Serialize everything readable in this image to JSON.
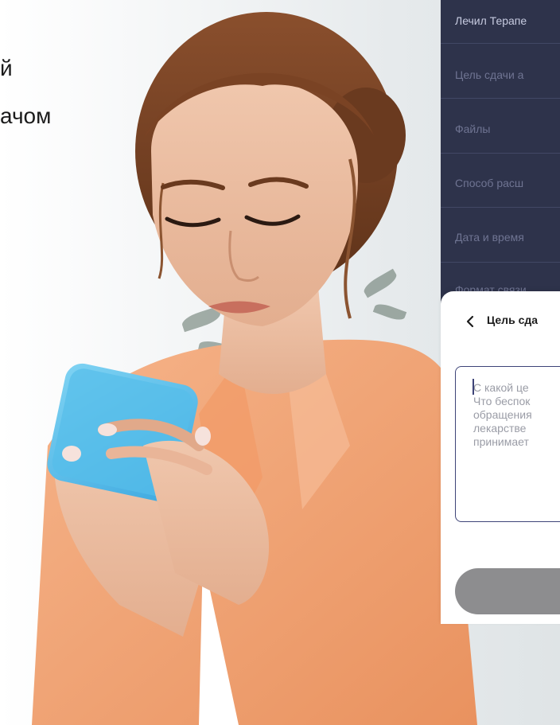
{
  "hero": {
    "line1": "й",
    "line2": "ачом"
  },
  "form": {
    "rows": [
      {
        "label": "Лечил Терапе",
        "active": true
      },
      {
        "label": "Цель сдачи а",
        "active": false
      },
      {
        "label": "Файлы",
        "active": false
      },
      {
        "label": "Способ расш",
        "active": false
      },
      {
        "label": "Дата и время",
        "active": false
      },
      {
        "label": "Формат связи",
        "active": false
      }
    ]
  },
  "sheet": {
    "title": "Цель сда",
    "back_icon": "chevron-left-icon",
    "textarea_placeholder": "С какой це\nЧто беспок\nобращения\nлекарстве\nпринимает",
    "submit_label": ""
  },
  "colors": {
    "panel_bg": "#2e334b",
    "panel_text_muted": "#6f7492",
    "panel_text_active": "#c7cbe0",
    "input_border": "#3e4478",
    "button_disabled": "#8d8d8f",
    "shirt": "#f2a67a"
  }
}
